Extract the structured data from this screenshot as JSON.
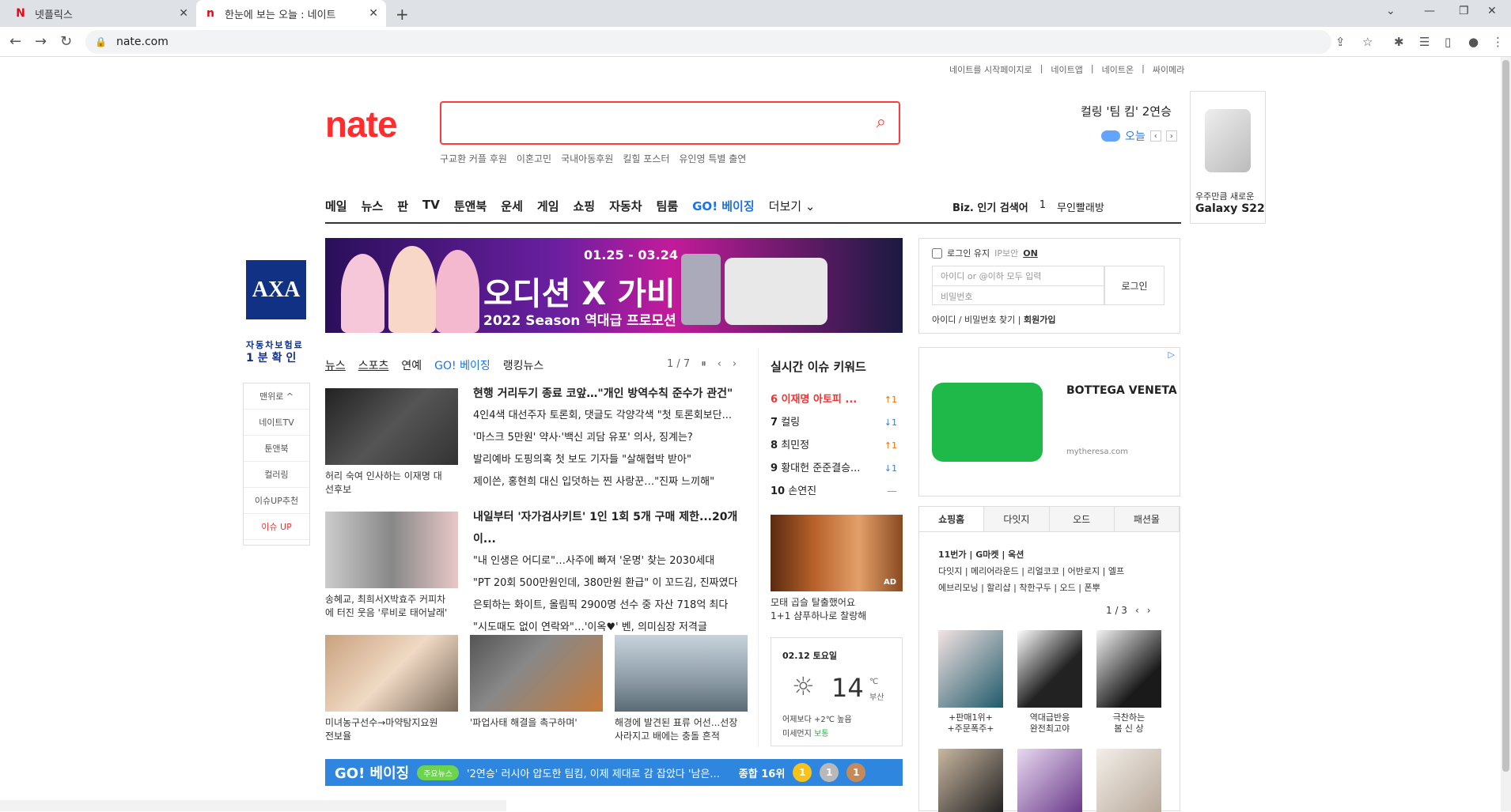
{
  "browser": {
    "tabs": [
      {
        "title": "넷플릭스",
        "favicon": "N"
      },
      {
        "title": "한눈에 보는 오늘 : 네이트",
        "favicon": "n"
      }
    ],
    "url": "nate.com"
  },
  "toplinks": [
    "네이트를 시작페이지로",
    "네이트앱",
    "네이트온",
    "싸이메라"
  ],
  "logo": "nate",
  "search": {
    "suggestions": [
      "구교환 커플 후원",
      "이혼고민",
      "국내아동후원",
      "킬힐 포스터",
      "유인영 특별 출연"
    ]
  },
  "headline": "컬링 '팀 킴' 2연승",
  "today": {
    "label": "오늘"
  },
  "sideAd": {
    "line1": "우주만큼 새로운",
    "line2": "Galaxy S22"
  },
  "mainnav": [
    "메일",
    "뉴스",
    "판",
    "TV",
    "툰앤북",
    "운세",
    "게임",
    "쇼핑",
    "자동차",
    "팀룸",
    "GO! 베이징",
    "더보기"
  ],
  "biz": {
    "label": "Biz. 인기 검색어",
    "rank": "1",
    "keyword": "무인빨래방"
  },
  "banner": {
    "dates": "01.25 - 03.24",
    "title": "오디션 X 가비",
    "sub": "2022 Season 역대급 프로모션"
  },
  "axa": {
    "logo": "AXA",
    "line1": "자동차보험료",
    "line2": "1분확인"
  },
  "sidemenu": [
    "맨위로 ^",
    "네이트TV",
    "툰앤북",
    "컬러링",
    "이슈UP추천",
    "이슈 UP"
  ],
  "newstabs": [
    "뉴스",
    "스포츠",
    "연예",
    "GO! 베이징",
    "랭킹뉴스"
  ],
  "newspager": "1 / 7",
  "news1": {
    "caption": [
      "허리 숙여 인사하는 이재명 대",
      "선후보"
    ],
    "items": [
      "현행 거리두기 종료 코앞…\"개인 방역수칙 준수가 관건\"",
      "4인4색 대선주자 토론회, 댓글도 각양각색 \"첫 토론회보단...",
      "'마스크 5만원' 약사·'백신 괴담 유포' 의사, 징계는?",
      "발리예바 도핑의혹 첫 보도 기자들 \"살해협박 받아\"",
      "제이쓴, 홍현희 대신 입덧하는 찐 사랑꾼…\"진짜 느끼해\""
    ]
  },
  "news2": {
    "caption": [
      "송혜교, 최희서X박효주 커피차",
      "에 터진 웃음 '루비로 태어날래'"
    ],
    "items": [
      "내일부터 '자가검사키트' 1인 1회 5개 구매 제한...20개이...",
      "\"내 인생은 어디로\"…사주에 빠져 '운명' 찾는 2030세대",
      "\"PT 20회 500만원인데, 380만원 환급\" 이 꼬드김, 진짜였다",
      "은퇴하는 화이트, 올림픽 2900명 선수 중 자산 718억 최다",
      "\"시도때도 없이 연락와\"…'이옥♥' 벤, 의미심장 저격글"
    ]
  },
  "news3": [
    {
      "caption": [
        "미녀농구선수→마약탐지요원",
        "전보율"
      ]
    },
    {
      "caption": [
        "'파업사태 해결을 촉구하며'"
      ]
    },
    {
      "caption": [
        "해경에 발견된 표류 어선...선장",
        "사라지고 배에는 충돌 흔적"
      ]
    }
  ],
  "realtime": {
    "title": "실시간 이슈 키워드",
    "items": [
      {
        "rank": "6",
        "kw": "이재명 아토피 ...",
        "change": "↑1",
        "dir": "up"
      },
      {
        "rank": "7",
        "kw": "컬링",
        "change": "↓1",
        "dir": "down"
      },
      {
        "rank": "8",
        "kw": "최민정",
        "change": "↑1",
        "dir": "up"
      },
      {
        "rank": "9",
        "kw": "황대헌 준준결승...",
        "change": "↓1",
        "dir": "down"
      },
      {
        "rank": "10",
        "kw": "손연진",
        "change": "—",
        "dir": "none"
      }
    ]
  },
  "hairad": {
    "badge": "AD",
    "caption": [
      "모태 곱슬 탈출했어요",
      "1+1 샴푸하나로 찰랑해"
    ]
  },
  "weather": {
    "date": "02.12 토요일",
    "temp": "14",
    "unit": "℃",
    "city": "부산",
    "line1": "어제보다 +2℃ 높음",
    "dust_label": "미세먼지",
    "dust": "보통"
  },
  "goBar": {
    "logo": "GO! 베이징",
    "badge": "주요뉴스",
    "text": "'2연승' 러시아 압도한 팀킴, 이제 제대로 감 잡았다 '남은...",
    "rank": "종합 16위",
    "medals": [
      "1",
      "1",
      "1"
    ]
  },
  "login": {
    "keep": "로그인 유지",
    "ip": "IP보안",
    "ip_state": "ON",
    "id_ph": "아이디 or @이하 모두 입력",
    "pw_ph": "비밀번호",
    "btn": "로그인",
    "find": "아이디 / 비밀번호 찾기",
    "join": "회원가입"
  },
  "botAd": {
    "brand": "BOTTEGA VENETA",
    "site": "mytheresa.com"
  },
  "shop": {
    "tabs": [
      "쇼핑홈",
      "다잇지",
      "오드",
      "패션몰"
    ],
    "links": [
      "11번가 | G마켓 | 옥션",
      "다잇지 | 메리어라운드 | 리얼코코 | 어반로지 | 엘프",
      "에브리모닝 | 할리샵 | 착한구두 | 오드 | 폰뿌"
    ],
    "pager": "1 / 3",
    "products": [
      {
        "caption": [
          "+판매1위+",
          "+주문폭주+"
        ]
      },
      {
        "caption": [
          "역대급반응",
          "완전최고야"
        ]
      },
      {
        "caption": [
          "극찬하는",
          "봄 신 상"
        ]
      }
    ]
  },
  "colors": {
    "brand": "#ff2d2d",
    "go": "#1a73e8",
    "goBar": "#2f86df",
    "axa": "#103184"
  }
}
